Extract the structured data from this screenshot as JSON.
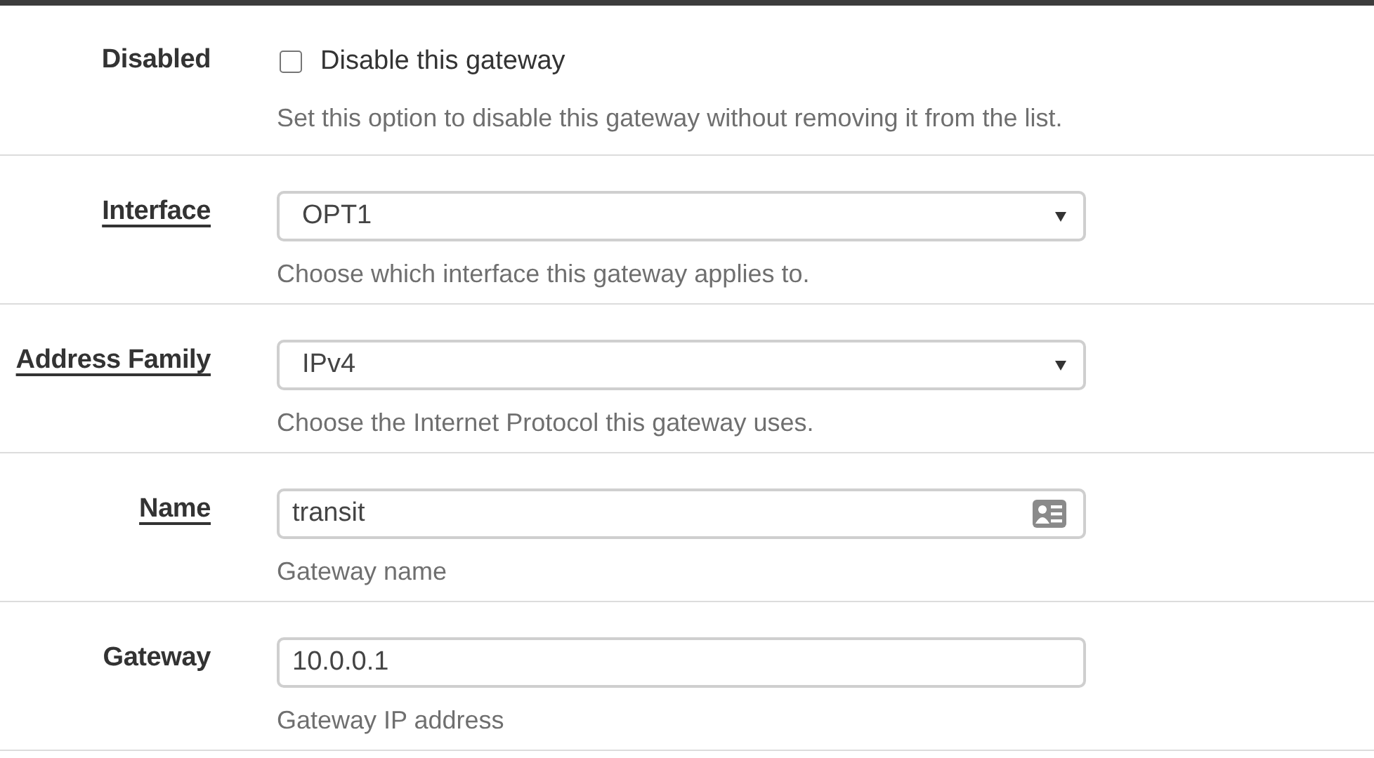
{
  "rows": [
    {
      "kind": "checkbox",
      "label": "Disabled",
      "linked": false,
      "checked": false,
      "option": "Disable this gateway",
      "help": "Set this option to disable this gateway without removing it from the list."
    },
    {
      "kind": "select",
      "label": "Interface",
      "linked": true,
      "value": "OPT1",
      "help": "Choose which interface this gateway applies to."
    },
    {
      "kind": "select",
      "label": "Address Family",
      "linked": true,
      "value": "IPv4",
      "help": "Choose the Internet Protocol this gateway uses."
    },
    {
      "kind": "text",
      "label": "Name",
      "linked": true,
      "value": "transit",
      "contact_icon": true,
      "help": "Gateway name"
    },
    {
      "kind": "text",
      "label": "Gateway",
      "linked": false,
      "value": "10.0.0.1",
      "contact_icon": false,
      "help": "Gateway IP address"
    }
  ]
}
